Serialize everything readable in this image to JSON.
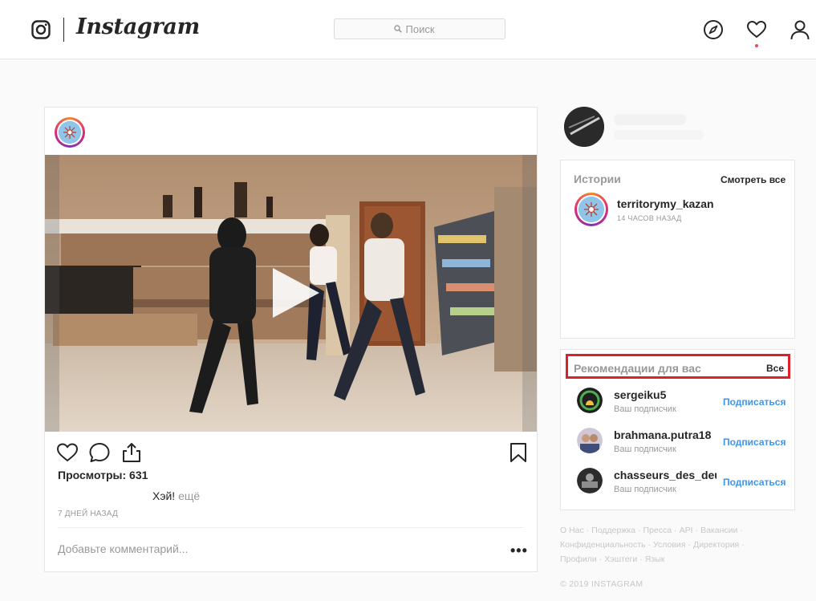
{
  "header": {
    "brand": "Instagram",
    "search_placeholder": "Поиск"
  },
  "post": {
    "views_label": "Просмотры: 631",
    "caption": "Хэй!",
    "more_label": "ещё",
    "time_ago": "7 ДНЕЙ НАЗАД",
    "comment_placeholder": "Добавьте комментарий...",
    "options_label": "•••"
  },
  "stories": {
    "title": "Истории",
    "view_all": "Смотреть все",
    "items": [
      {
        "username": "territorymy_kazan",
        "time": "14 ЧАСОВ НАЗАД"
      }
    ]
  },
  "recommendations": {
    "title": "Рекомендации для вас",
    "all_label": "Все",
    "highlight_color": "#d9222a",
    "items": [
      {
        "username": "sergeiku5",
        "subtitle": "Ваш подписчик",
        "action": "Подписаться"
      },
      {
        "username": "brahmana.putra18",
        "subtitle": "Ваш подписчик",
        "action": "Подписаться"
      },
      {
        "username": "chasseurs_des_deux_",
        "subtitle": "Ваш подписчик",
        "action": "Подписаться"
      }
    ]
  },
  "footer": {
    "links": [
      "О Нас",
      "Поддержка",
      "Пресса",
      "API",
      "Вакансии",
      "Конфиденциальность",
      "Условия",
      "Директория",
      "Профили",
      "Хэштеги",
      "Язык"
    ],
    "copyright": "© 2019 INSTAGRAM"
  },
  "colors": {
    "link_blue": "#3897f0",
    "notification_dot": "#ed4956",
    "border": "#e6e6e6"
  },
  "icons": {
    "logo": "instagram-glyph-icon",
    "explore": "compass-icon",
    "activity": "heart-icon",
    "profile": "person-icon",
    "like": "heart-outline-icon",
    "comment": "speech-bubble-icon",
    "share": "share-icon",
    "save": "bookmark-icon",
    "play": "play-icon"
  }
}
